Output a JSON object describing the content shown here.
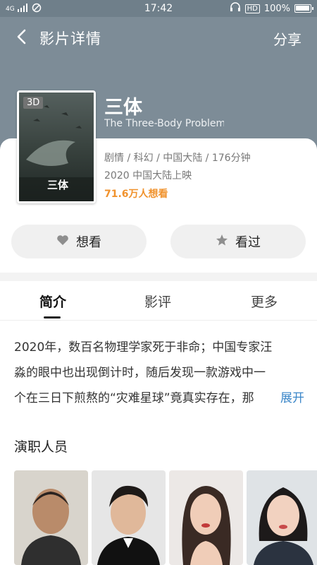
{
  "status_bar": {
    "network": "4G",
    "time": "17:42",
    "battery": "100%",
    "battery_level": 1.0
  },
  "nav": {
    "title": "影片详情",
    "share": "分享"
  },
  "movie": {
    "badge": "3D",
    "poster_text": "三体",
    "title": "三体",
    "subtitle": "The Three-Body Problem: I",
    "genre_line": "剧情 / 科幻 / 中国大陆 / 176分钟",
    "release_line": "2020 中国大陆上映",
    "want_count": "71.6万人想看"
  },
  "actions": {
    "want_label": "想看",
    "seen_label": "看过"
  },
  "tabs": [
    "简介",
    "影评",
    "更多"
  ],
  "synopsis": {
    "lines": [
      "2020年，数百名物理学家死于非命；中国专家汪",
      "淼的眼中也出现倒计时，随后发现一款游戏中一",
      "个在三日下煎熬的“灾难星球”竟真实存在，那"
    ],
    "expand": "展开"
  },
  "cast": {
    "heading": "演职人员",
    "icons": [
      "person-photo-1",
      "person-photo-2",
      "person-photo-3",
      "person-photo-4"
    ]
  },
  "colors": {
    "hero": "#7d8c97",
    "want_accent": "#f0922d",
    "link": "#3a86c8"
  }
}
